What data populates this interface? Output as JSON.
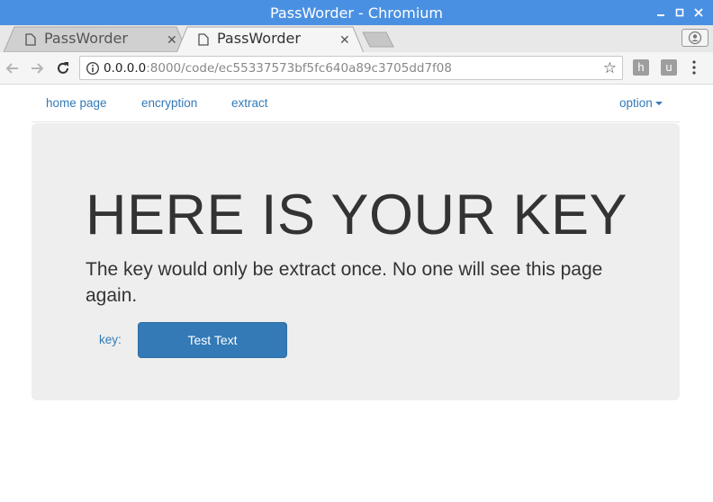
{
  "window": {
    "title": "PassWorder - Chromium"
  },
  "tabs": [
    {
      "label": "PassWorder",
      "active": false
    },
    {
      "label": "PassWorder",
      "active": true
    }
  ],
  "address": {
    "host": "0.0.0.0",
    "rest": ":8000/code/ec55337573bf5fc640a89c3705dd7f08"
  },
  "extensions": {
    "h": "h",
    "u": "u"
  },
  "nav": {
    "home": "home page",
    "encryption": "encryption",
    "extract": "extract",
    "option": "option"
  },
  "main": {
    "heading": "HERE IS YOUR KEY",
    "lead": "The key would only be extract once. No one will see this page again.",
    "key_label": "key:",
    "key_value": "Test Text"
  },
  "colors": {
    "titlebar": "#4a90e2",
    "link": "#337ab7",
    "primary_button": "#337ab7",
    "jumbotron": "#eeeeee"
  }
}
